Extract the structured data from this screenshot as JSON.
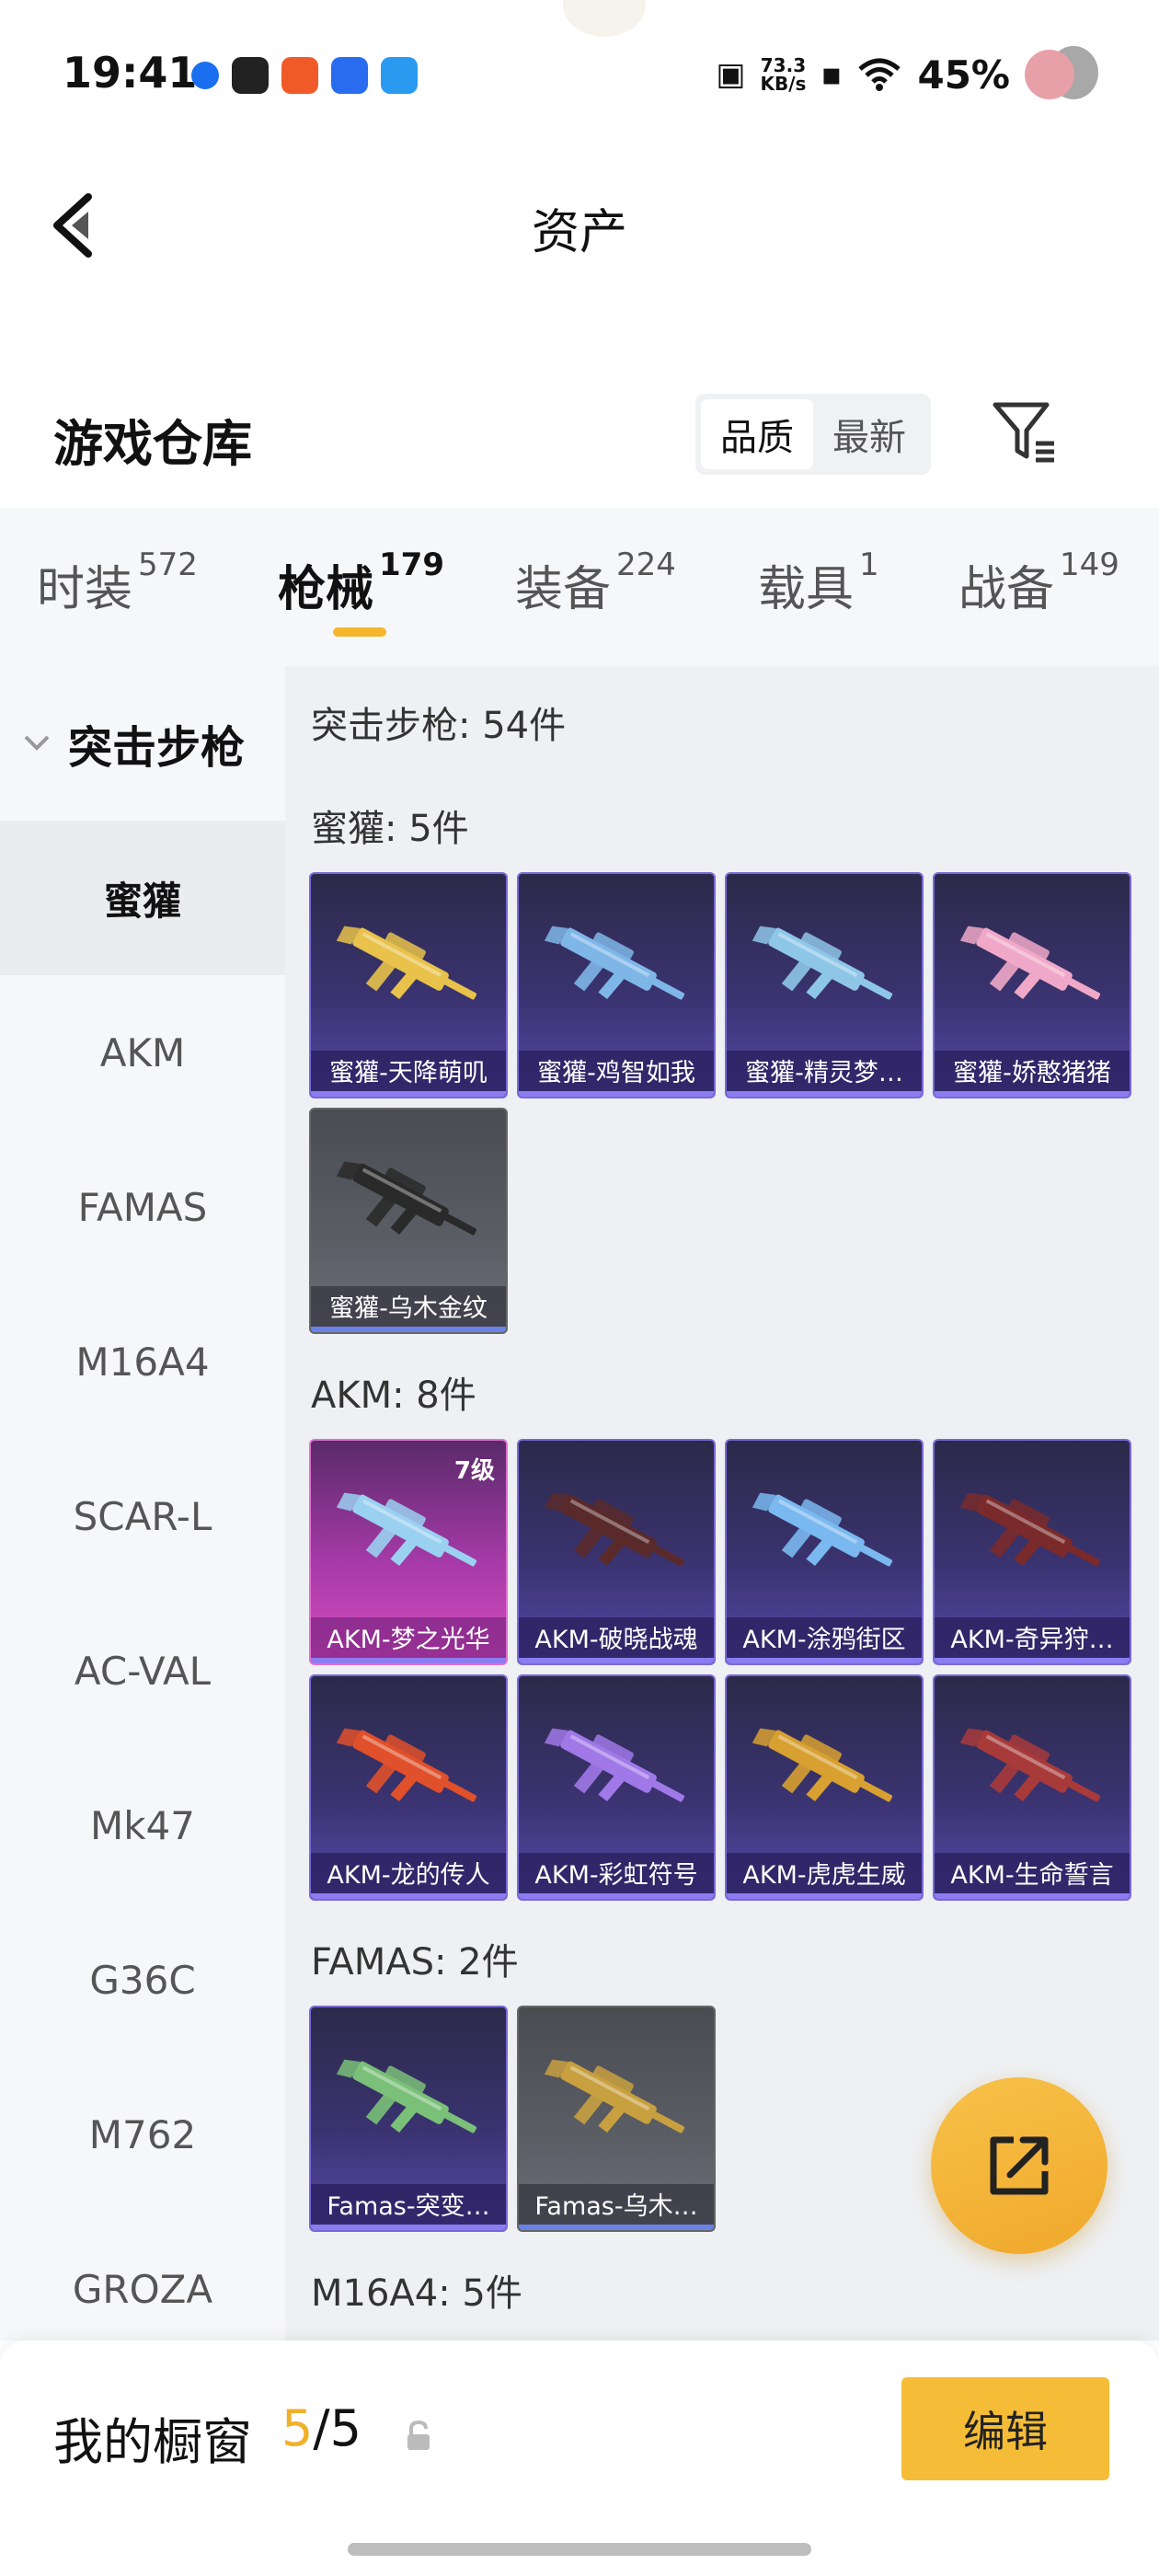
{
  "status_bar": {
    "time": "19:41",
    "net_speed_value": "73.3",
    "net_speed_unit": "KB/s",
    "battery": "45%"
  },
  "nav": {
    "title": "资产"
  },
  "section": {
    "title": "游戏仓库",
    "sort_options": [
      "品质",
      "最新"
    ],
    "sort_selected": "品质"
  },
  "tabs": [
    {
      "label": "时装",
      "count": "572"
    },
    {
      "label": "枪械",
      "count": "179"
    },
    {
      "label": "装备",
      "count": "224"
    },
    {
      "label": "载具",
      "count": "1"
    },
    {
      "label": "战备",
      "count": "149"
    }
  ],
  "sidebar": {
    "group": "突击步枪",
    "items": [
      "蜜獾",
      "AKM",
      "FAMAS",
      "M16A4",
      "SCAR-L",
      "AC-VAL",
      "Mk47",
      "G36C",
      "M762",
      "GROZA"
    ]
  },
  "main": {
    "category_count": "突击步枪: 54件",
    "groups": [
      {
        "header": "蜜獾: 5件",
        "items": [
          {
            "name": "蜜獾-天降萌叽",
            "style": "purple",
            "color": "#e8c24a"
          },
          {
            "name": "蜜獾-鸡智如我",
            "style": "purple",
            "color": "#7fb6e8"
          },
          {
            "name": "蜜獾-精灵梦…",
            "style": "purple",
            "color": "#8ec6e8"
          },
          {
            "name": "蜜獾-娇憨猪猪",
            "style": "purple",
            "color": "#f0a8c8"
          },
          {
            "name": "蜜獾-乌木金纹",
            "style": "grey",
            "color": "#2a2a2a"
          }
        ]
      },
      {
        "header": "AKM: 8件",
        "items": [
          {
            "name": "AKM-梦之光华",
            "style": "pink",
            "color": "#9ad0f0",
            "level": "7级"
          },
          {
            "name": "AKM-破晓战魂",
            "style": "purple",
            "color": "#5a2a2a"
          },
          {
            "name": "AKM-涂鸦街区",
            "style": "purple",
            "color": "#7ab8f0"
          },
          {
            "name": "AKM-奇异狩…",
            "style": "purple",
            "color": "#7a2a2a"
          },
          {
            "name": "AKM-龙的传人",
            "style": "purple",
            "color": "#e0502a"
          },
          {
            "name": "AKM-彩虹符号",
            "style": "purple",
            "color": "#a078e8"
          },
          {
            "name": "AKM-虎虎生威",
            "style": "purple",
            "color": "#d8a030"
          },
          {
            "name": "AKM-生命誓言",
            "style": "purple",
            "color": "#a83a3a"
          }
        ]
      },
      {
        "header": "FAMAS: 2件",
        "items": [
          {
            "name": "Famas-突变…",
            "style": "purple",
            "color": "#7ac078"
          },
          {
            "name": "Famas-乌木…",
            "style": "grey",
            "color": "#c8a040"
          }
        ]
      },
      {
        "header": "M16A4: 5件",
        "items": []
      }
    ]
  },
  "bottom": {
    "label": "我的橱窗",
    "count_used": "5",
    "count_sep": "/",
    "count_total": "5",
    "edit_label": "编辑"
  },
  "colors": {
    "accent": "#f5bd37",
    "card_border": "#7a68d8"
  }
}
